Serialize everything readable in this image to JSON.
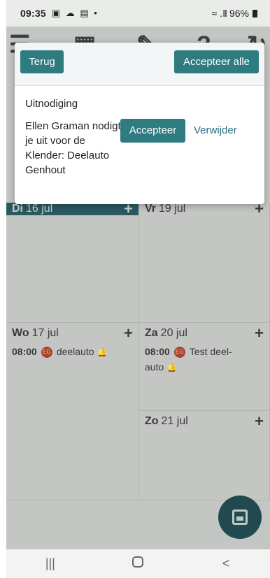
{
  "statusbar": {
    "time": "09:35",
    "icons": "▣ ☁ ▤ •",
    "signal": "≈ .Ⅱ",
    "battery": "96%"
  },
  "toolbar": {
    "icons": [
      "menu-icon",
      "calendar-icon",
      "edit-checklist-icon",
      "help-icon",
      "refresh-icon"
    ]
  },
  "calendar": {
    "days": [
      {
        "weekday": "Di",
        "date": "16",
        "month": "jul",
        "selected": true
      },
      {
        "weekday": "Vr",
        "date": "19",
        "month": "jul"
      },
      {
        "weekday": "Wo",
        "date": "17",
        "month": "jul"
      },
      {
        "weekday": "Za",
        "date": "20",
        "month": "jul"
      },
      {
        "weekday": "Zo",
        "date": "21",
        "month": "jul"
      }
    ],
    "plus": "+",
    "events": [
      {
        "time": "08:00",
        "initials": "EG",
        "title": "deelauto"
      },
      {
        "time": "08:00",
        "initials": "EG",
        "title": "Test deel-",
        "title2": "auto"
      }
    ]
  },
  "dialog": {
    "back": "Terug",
    "accept_all": "Accepteer alle",
    "title": "Uitnodiging",
    "message": "Ellen Graman nodigt je uit voor de Klender: Deelauto Genhout",
    "accept": "Accepteer",
    "remove": "Verwijder"
  },
  "navbar": {
    "recent": "|||",
    "back": "<"
  },
  "colors": {
    "accent": "#2e7b80",
    "header_selected": "#2a5960",
    "link": "#2e6d84"
  }
}
